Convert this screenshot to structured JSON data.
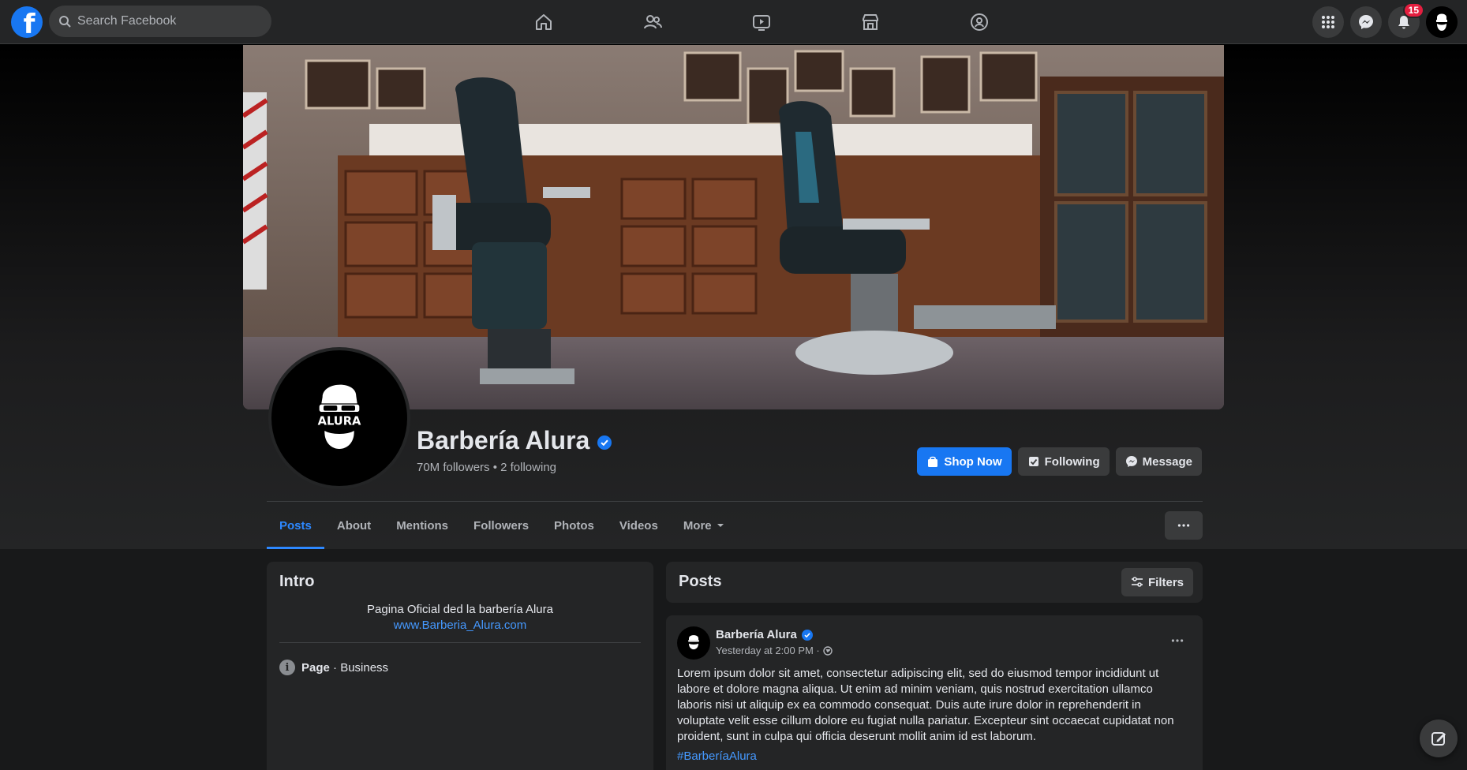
{
  "colors": {
    "accent": "#1877f2",
    "link": "#4599ff",
    "background": "#18191a",
    "surface": "#242526",
    "badge": "#e41e3f"
  },
  "topnav": {
    "logo_icon": "facebook-logo",
    "logo_glyph": "f",
    "search": {
      "placeholder": "Search Facebook",
      "value": ""
    },
    "tabs": [
      {
        "icon": "home-icon"
      },
      {
        "icon": "friends-icon"
      },
      {
        "icon": "watch-icon"
      },
      {
        "icon": "marketplace-icon"
      },
      {
        "icon": "groups-icon"
      }
    ],
    "right": {
      "menu_icon": "grid-menu-icon",
      "messenger_icon": "messenger-icon",
      "notifications_icon": "bell-icon",
      "notifications_count": "15",
      "account_icon": "account-avatar"
    }
  },
  "profile": {
    "name": "Barbería Alura",
    "verified": true,
    "stats": "70M followers • 2 following",
    "logo_text": "ALURA",
    "actions": {
      "shop": "Shop Now",
      "following": "Following",
      "message": "Message"
    },
    "tabs": [
      "Posts",
      "About",
      "Mentions",
      "Followers",
      "Photos",
      "Videos",
      "More"
    ],
    "active_tab": "Posts"
  },
  "intro": {
    "title": "Intro",
    "description": "Pagina Oficial ded la barbería Alura",
    "website": "www.Barberia_Alura.com",
    "category_label": "Page",
    "category_value": " · Business"
  },
  "posts": {
    "title": "Posts",
    "filters_label": "Filters",
    "items": [
      {
        "author": "Barbería Alura",
        "time": "Yesterday at 2:00 PM ·",
        "privacy_icon": "globe-icon",
        "lines": [
          "Lorem ipsum dolor sit amet, consectetur adipiscing elit, sed do eiusmod tempor incididunt ut",
          "labore et dolore magna aliqua. Ut enim ad minim veniam, quis nostrud exercitation ullamco",
          "laboris nisi ut aliquip ex ea commodo consequat. Duis aute irure dolor in reprehenderit in",
          "voluptate velit esse cillum dolore eu fugiat nulla pariatur. Excepteur sint occaecat cupidatat non",
          "proident, sunt in culpa qui officia deserunt mollit anim id est laborum."
        ],
        "hashtag": "#BarberíaAlura"
      }
    ]
  }
}
